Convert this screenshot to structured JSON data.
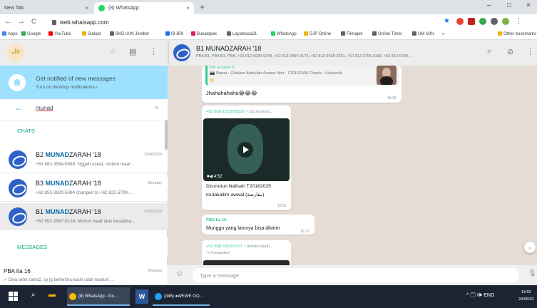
{
  "browser": {
    "tabs": [
      {
        "label": "New Tab",
        "close": "×"
      },
      {
        "label": "(8) WhatsApp",
        "close": "×"
      }
    ],
    "new_tab": "+",
    "window_controls": [
      "–",
      "□",
      "×"
    ],
    "nav": {
      "back": "←",
      "forward": "→",
      "reload": "C"
    },
    "url": "web.whatsapp.com",
    "bookmarks": [
      {
        "label": "Apps",
        "color": "#4285f4"
      },
      {
        "label": "Google",
        "color": "#34a853"
      },
      {
        "label": "YouTube",
        "color": "#ff0000"
      },
      {
        "label": "Siakad",
        "color": "#f4b400"
      },
      {
        "label": "BKD IAIN Jember",
        "color": "#5f6368"
      },
      {
        "label": "IB BRI",
        "color": "#1a73e8"
      },
      {
        "label": "Bukalapak",
        "color": "#e31e52"
      },
      {
        "label": "Layarkaca21",
        "color": "#5f6368"
      },
      {
        "label": "WhatsApp",
        "color": "#25d366"
      },
      {
        "label": "DJP Online",
        "color": "#f4b400"
      },
      {
        "label": "Filmapik",
        "color": "#5f6368"
      },
      {
        "label": "Online Timer",
        "color": "#5f6368"
      },
      {
        "label": "UM IAIN",
        "color": "#5f6368"
      }
    ],
    "bookmarks_more": "»",
    "other_bookmarks": "Other bookmarks"
  },
  "sidebar": {
    "avatar_text": "اللّه",
    "notification": {
      "title": "Get notified of new messages",
      "subtitle": "Turn on desktop notifications ›"
    },
    "search": {
      "value": "munad",
      "back": "←",
      "clear": "×"
    },
    "chats_heading": "CHATS",
    "chats": [
      {
        "prefix": "B2 ",
        "match": "MUNAD",
        "suffix": "ZARAH '18",
        "date": "5/24/2020",
        "last": "+62 882-3584-5989: Nggeh ustad, mohon maaf..."
      },
      {
        "prefix": "B3 ",
        "match": "MUNAD",
        "suffix": "ZARAH '18",
        "date": "Monday",
        "last": "+62 853-3620-5484 changed to +62 822-5709-..."
      },
      {
        "prefix": "B1 ",
        "match": "MUNAD",
        "suffix": "ZARAH '18",
        "date": "5/23/2020",
        "last": "+62 852-3587-9124: Mohon maaf atas kesalaha..."
      }
    ],
    "messages_heading": "MESSAGES",
    "message_result": {
      "name": "PBA Ita 16",
      "date": "Monday",
      "last": "✓ Oiya ukhti sama2, sy jg berterima kasih udah bantuin ..."
    }
  },
  "conversation": {
    "title": "B1 MUNADZARAH '18",
    "members": "PBA B1, PBA B1, PBA, +62 812-5939-9348, +62 813-3404-9173, +62 813-3428-3261, +62 813-3755-9198, +62 813-5789-...",
    "icons": {
      "search": "⌕",
      "attach": "⊘",
      "menu": "⋮"
    },
    "messages": [
      {
        "quote_head": "Kim as Azam Ti",
        "quote_text": "📷 Nama : Ghulam Abdullah Azzam Nim : T20162005 Firqoh : Hukumah",
        "quote_emoji": "😎",
        "text": "Jhahahahaha😂😂😂",
        "time": "16:19"
      },
      {
        "sender": "+62 859-1713-08518",
        "sender_name": " ~ Dzurrotunn...",
        "video_duration": "■◀ 4:52",
        "caption1": "Dzurrotun Nafisah T20182025",
        "caption2": "mutakallim awwal (مقارضة)",
        "time": "16:21"
      },
      {
        "sender": "PBA Ita 16",
        "text": "Monggo yang lainnya bisa dikirim",
        "time": "16:22"
      },
      {
        "sender": "+62 838-5353-5777",
        "sender_name": " ~ Amelia Ayuh...",
        "forwarded": "↪ Forwarded"
      }
    ],
    "scroll_down": "⌄",
    "compose": {
      "placeholder": "Type a message",
      "emoji": "☺",
      "mic": "🎙"
    }
  },
  "taskbar": {
    "apps": [
      {
        "label": "(8) WhatsApp - Go...",
        "color": "#fbbc04"
      },
      {
        "label": "(346) ●WEWE GO...",
        "color": "#1da1f2"
      }
    ],
    "word_label": "W",
    "tray_text": "^ 🗔 🕪 ENG",
    "time": "13:02",
    "date": "24/06/20"
  }
}
